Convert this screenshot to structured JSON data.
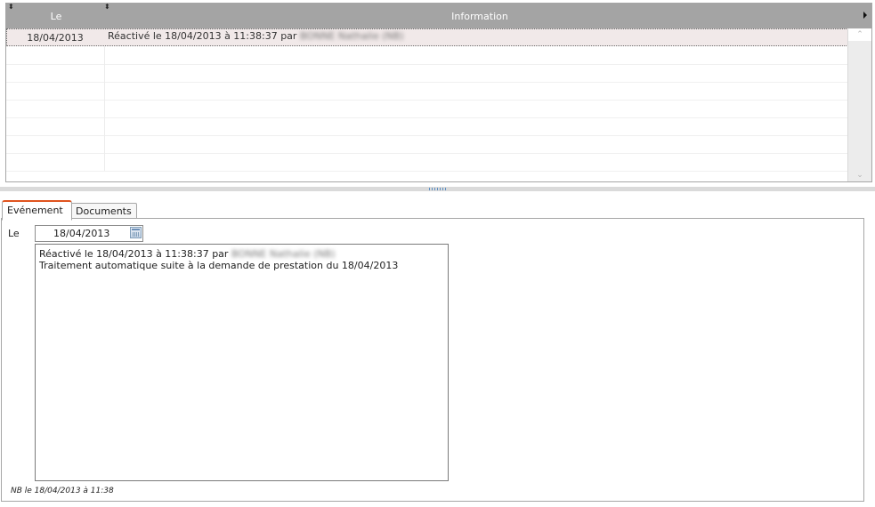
{
  "grid": {
    "columns": {
      "le": "Le",
      "information": "Information"
    },
    "rows": [
      {
        "date": "18/04/2013",
        "info_prefix": "Réactivé le 18/04/2013 à 11:38:37 par",
        "info_blurred": "BONNE Nathalie (NB)",
        "selected": true
      }
    ],
    "scrollbar": {
      "up": "⌃",
      "down": "⌄"
    }
  },
  "tabs": {
    "evenement": "Evénement",
    "documents": "Documents"
  },
  "form": {
    "le_label": "Le",
    "date_value": "18/04/2013",
    "memo_line1_prefix": "Réactivé le 18/04/2013 à 11:38:37 par",
    "memo_line1_blurred": "BONNE Nathalie (NB)",
    "memo_line2": "Traitement automatique suite à la demande de prestation  du 18/04/2013"
  },
  "footer_note": "NB le 18/04/2013 à 11:38",
  "colors": {
    "header_bg": "#a4a4a4",
    "selected_row": "#f1e9e9",
    "active_tab_accent": "#e0541f"
  },
  "icons": [
    "sort-indicator-icon",
    "column-menu-arrow-icon",
    "scroll-up-icon",
    "scroll-down-icon",
    "splitter-grip-icon",
    "calendar-icon"
  ]
}
